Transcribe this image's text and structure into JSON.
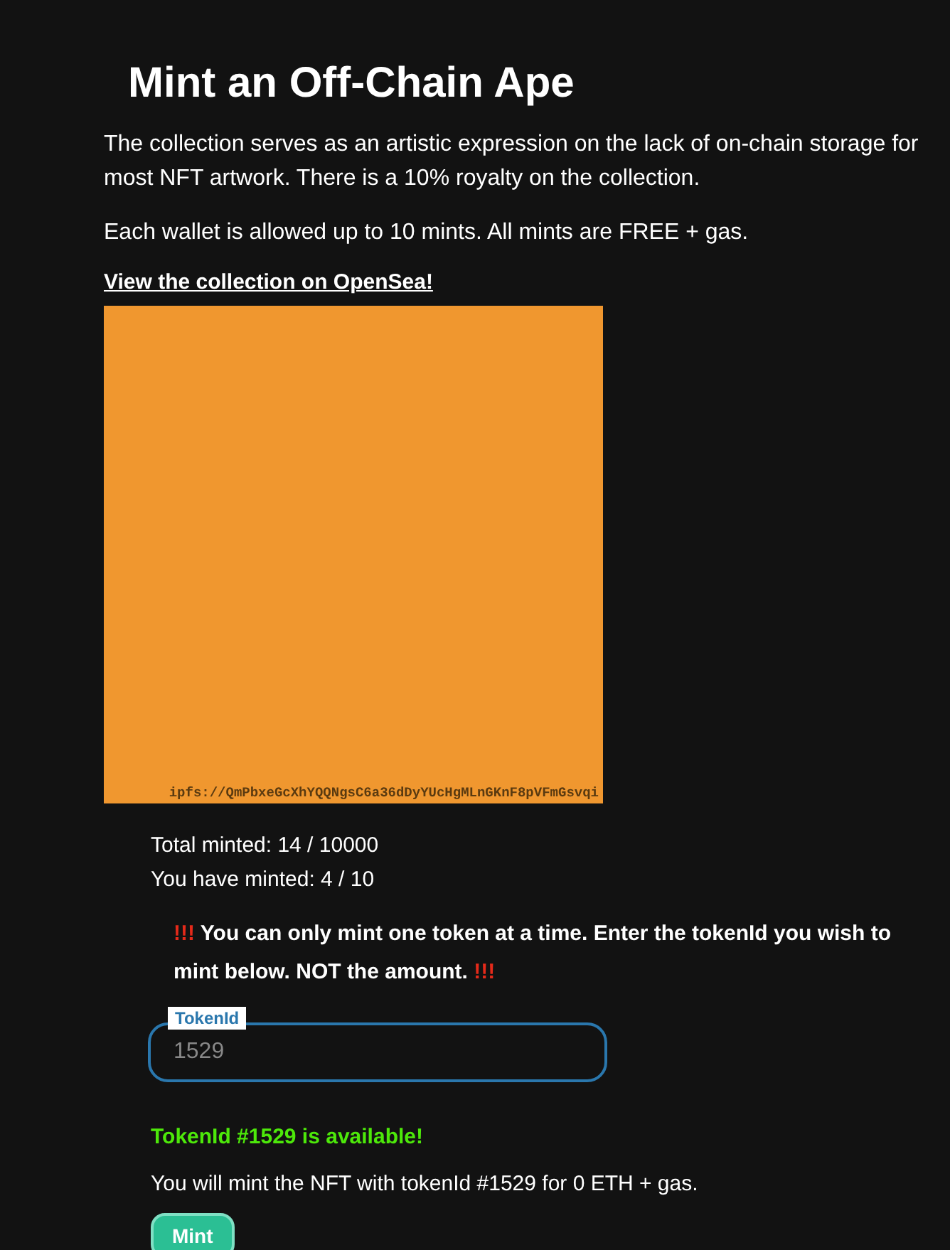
{
  "title": "Mint an Off-Chain Ape",
  "paragraphs": [
    "The collection serves as an artistic expression on the lack of on-chain storage for most NFT artwork. There is a 10% royalty on the collection.",
    "Each wallet is allowed up to 10 mints. All mints are FREE + gas."
  ],
  "link": "View the collection on OpenSea!",
  "artwork": {
    "color": "#f0972f",
    "caption": "ipfs://QmPbxeGcXhYQQNgsC6a36dDyYUcHgMLnGKnF8pVFmGsvqi"
  },
  "stats": [
    "Total minted: 14 / 10000",
    "You have minted: 4 / 10"
  ],
  "warning": {
    "marks_before": "!!!",
    "text": "You can only mint one token at a time. Enter the tokenId you wish to mint below. NOT the amount.",
    "marks_after": "!!!"
  },
  "token_field": {
    "label": "TokenId",
    "value": "1529"
  },
  "availability": "TokenId #1529 is available!",
  "summary": "You will mint the NFT with tokenId #1529 for 0 ETH + gas.",
  "mint_button": "Mint"
}
